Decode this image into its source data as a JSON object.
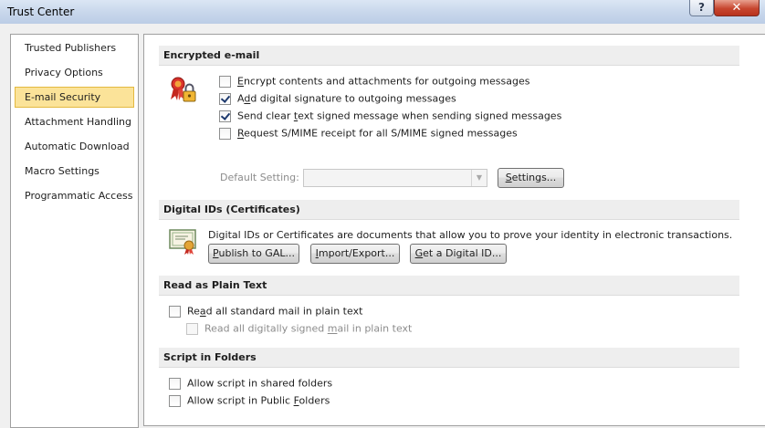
{
  "window": {
    "title": "Trust Center",
    "help_glyph": "?",
    "close_glyph": "✕"
  },
  "sidebar": {
    "items": [
      {
        "label": "Trusted Publishers",
        "selected": false
      },
      {
        "label": "Privacy Options",
        "selected": false
      },
      {
        "label": "E-mail Security",
        "selected": true
      },
      {
        "label": "Attachment Handling",
        "selected": false
      },
      {
        "label": "Automatic Download",
        "selected": false
      },
      {
        "label": "Macro Settings",
        "selected": false
      },
      {
        "label": "Programmatic Access",
        "selected": false
      }
    ]
  },
  "encrypted": {
    "header": "Encrypted e-mail",
    "icon": "certificate-lock-icon",
    "options": [
      {
        "pre": "",
        "ul": "E",
        "post": "ncrypt contents and attachments for outgoing messages",
        "checked": false
      },
      {
        "pre": "A",
        "ul": "d",
        "post": "d digital signature to outgoing messages",
        "checked": true
      },
      {
        "pre": "Send clear ",
        "ul": "t",
        "post": "ext signed message when sending signed messages",
        "checked": true
      },
      {
        "pre": "",
        "ul": "R",
        "post": "equest S/MIME receipt for all S/MIME signed messages",
        "checked": false
      }
    ],
    "default_setting_label": "Default Setting:",
    "default_setting_value": "",
    "settings_button": {
      "pre": "",
      "ul": "S",
      "post": "ettings..."
    }
  },
  "digital_ids": {
    "header": "Digital IDs (Certificates)",
    "icon": "certificate-icon",
    "description": "Digital IDs or Certificates are documents that allow you to prove your identity in electronic transactions.",
    "buttons": [
      {
        "pre": "",
        "ul": "P",
        "post": "ublish to GAL..."
      },
      {
        "pre": "",
        "ul": "I",
        "post": "mport/Export..."
      },
      {
        "pre": "",
        "ul": "G",
        "post": "et a Digital ID..."
      }
    ]
  },
  "plain_text": {
    "header": "Read as Plain Text",
    "options": [
      {
        "pre": "Re",
        "ul": "a",
        "post": "d all standard mail in plain text",
        "checked": false,
        "disabled": false
      },
      {
        "pre": "Read all digitally signed ",
        "ul": "m",
        "post": "ail in plain text",
        "checked": false,
        "disabled": true
      }
    ]
  },
  "script_folders": {
    "header": "Script in Folders",
    "options": [
      {
        "pre": "Allow script in shared folders",
        "ul": "",
        "post": "",
        "checked": false
      },
      {
        "pre": "Allow script in Public ",
        "ul": "F",
        "post": "olders",
        "checked": false
      }
    ]
  }
}
